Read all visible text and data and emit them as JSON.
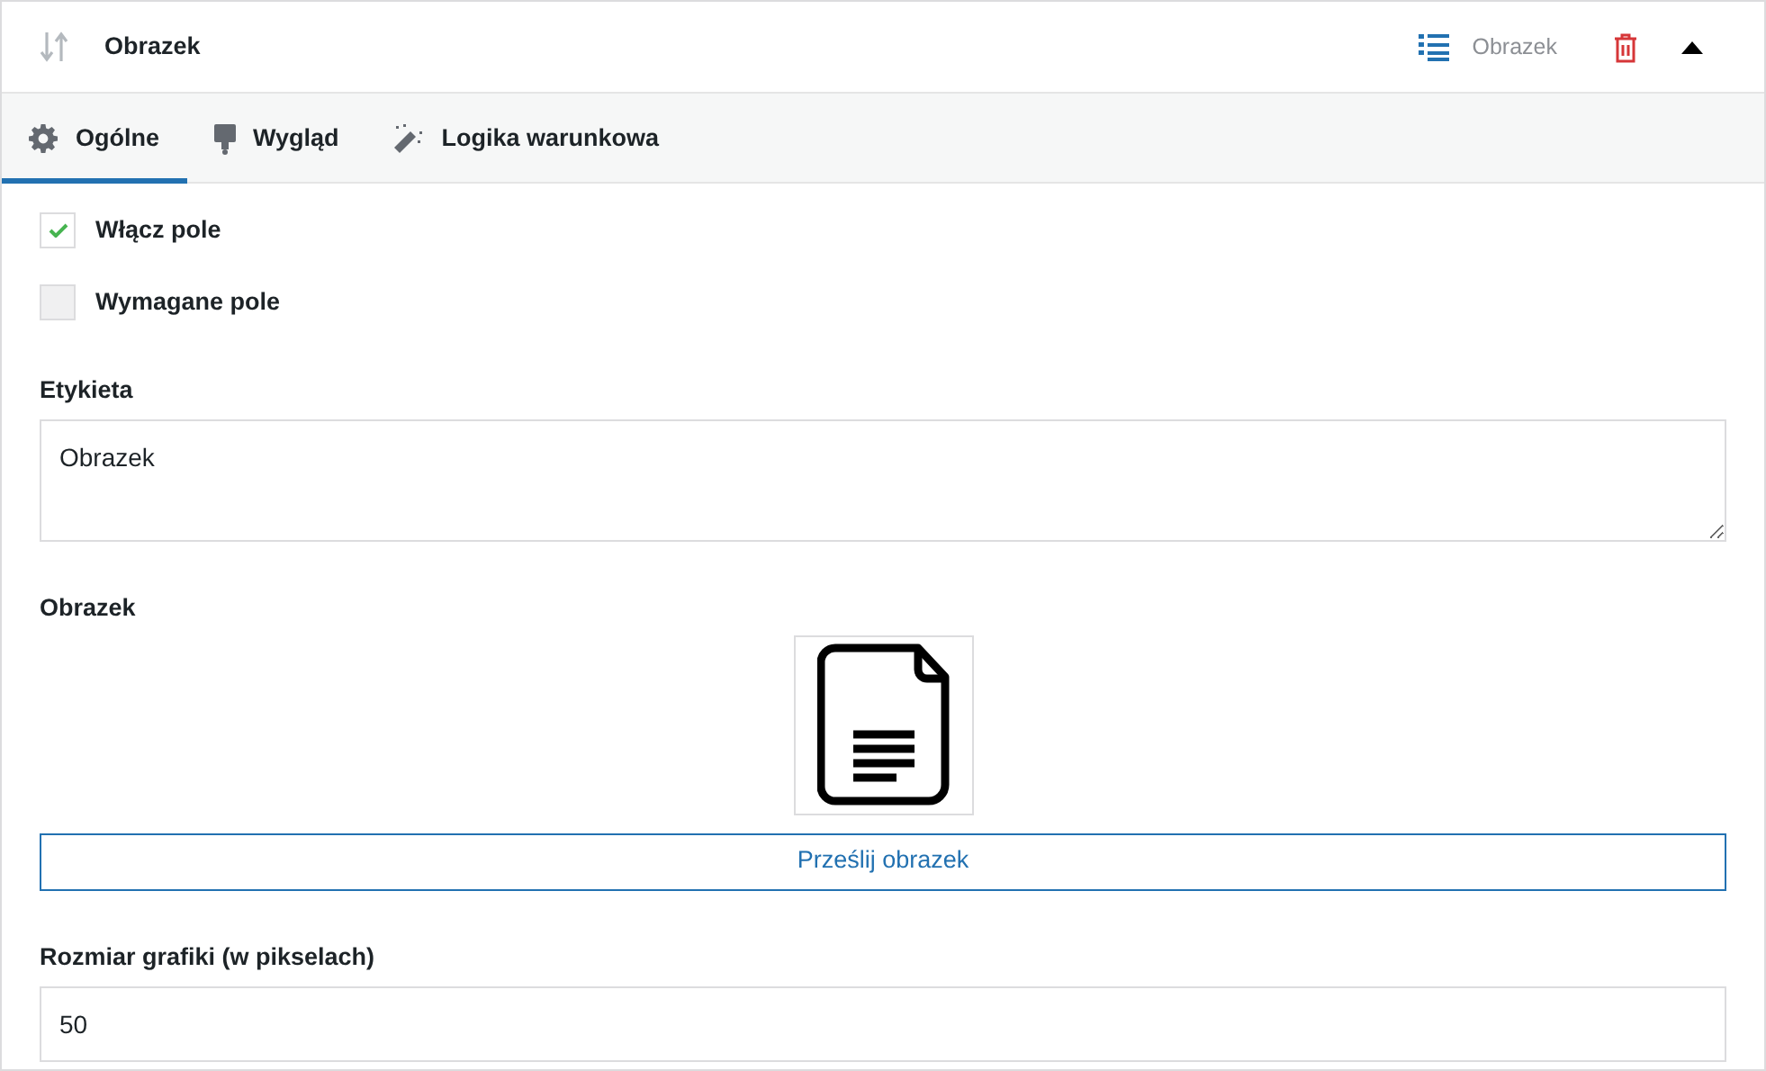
{
  "header": {
    "title": "Obrazek",
    "type_label": "Obrazek",
    "expanded": true
  },
  "tabs": [
    {
      "label": "Ogólne",
      "kind": "settings",
      "selected": true
    },
    {
      "label": "Wygląd",
      "kind": "appearance",
      "selected": false
    },
    {
      "label": "Logika warunkowa",
      "kind": "logic",
      "selected": false
    }
  ],
  "checkboxes": [
    {
      "label": "Włącz pole",
      "checked": true
    },
    {
      "label": "Wymagane pole",
      "checked": false
    }
  ],
  "label_field": {
    "label": "Etykieta",
    "value": "Obrazek"
  },
  "image_field": {
    "label": "Obrazek",
    "button": "Prześlij obrazek"
  },
  "size_field": {
    "label": "Rozmiar grafiki (w pikselach)",
    "value": "50"
  }
}
